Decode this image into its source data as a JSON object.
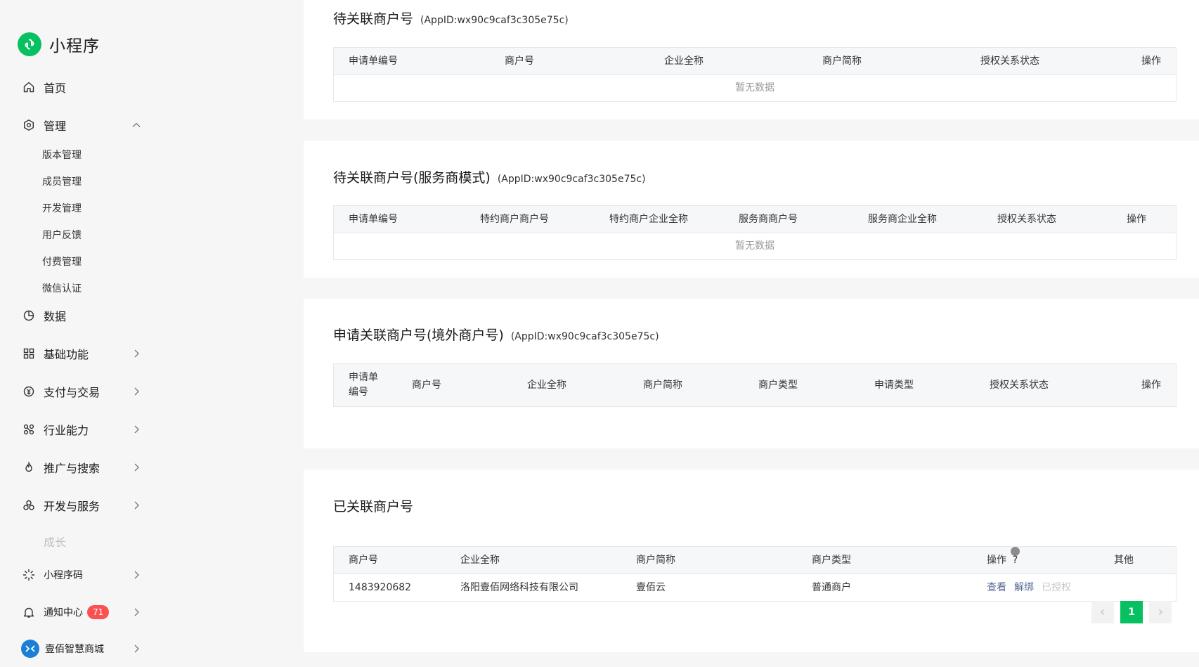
{
  "app": {
    "title": "小程序",
    "brand_color": "#07c160"
  },
  "sidebar": {
    "home": "首页",
    "manage": "管理",
    "manage_sub": [
      "版本管理",
      "成员管理",
      "开发管理",
      "用户反馈",
      "付费管理",
      "微信认证"
    ],
    "data": "数据",
    "basic": "基础功能",
    "pay": "支付与交易",
    "industry": "行业能力",
    "promo": "推广与搜索",
    "devsvc": "开发与服务",
    "growth": "成长",
    "qrcode": "小程序码",
    "notify": "通知中心",
    "notify_count": "71",
    "account": "壹佰智慧商城"
  },
  "section1": {
    "title": "待关联商户号",
    "appid": "(AppID:wx90c9caf3c305e75c)",
    "columns": [
      "申请单编号",
      "商户号",
      "企业全称",
      "商户简称",
      "授权关系状态",
      "操作"
    ],
    "empty": "暂无数据"
  },
  "section2": {
    "title": "待关联商户号(服务商模式)",
    "appid": "(AppID:wx90c9caf3c305e75c)",
    "columns": [
      "申请单编号",
      "特约商户商户号",
      "特约商户企业全称",
      "服务商商户号",
      "服务商企业全称",
      "授权关系状态",
      "操作"
    ],
    "empty": "暂无数据"
  },
  "section3": {
    "title": "申请关联商户号(境外商户号)",
    "appid": "(AppID:wx90c9caf3c305e75c)",
    "columns": [
      "申请单编号",
      "商户号",
      "企业全称",
      "商户简称",
      "商户类型",
      "申请类型",
      "授权关系状态",
      "操作"
    ]
  },
  "section4": {
    "title": "已关联商户号",
    "columns": [
      "商户号",
      "企业全称",
      "商户简称",
      "商户类型",
      "操作",
      "其他"
    ],
    "help": "?",
    "rows": [
      {
        "mchid": "1483920682",
        "company": "洛阳壹佰网络科技有限公司",
        "short": "壹佰云",
        "type": "普通商户",
        "view": "查看",
        "unbind": "解绑",
        "authorized": "已授权"
      }
    ],
    "page": "1"
  }
}
